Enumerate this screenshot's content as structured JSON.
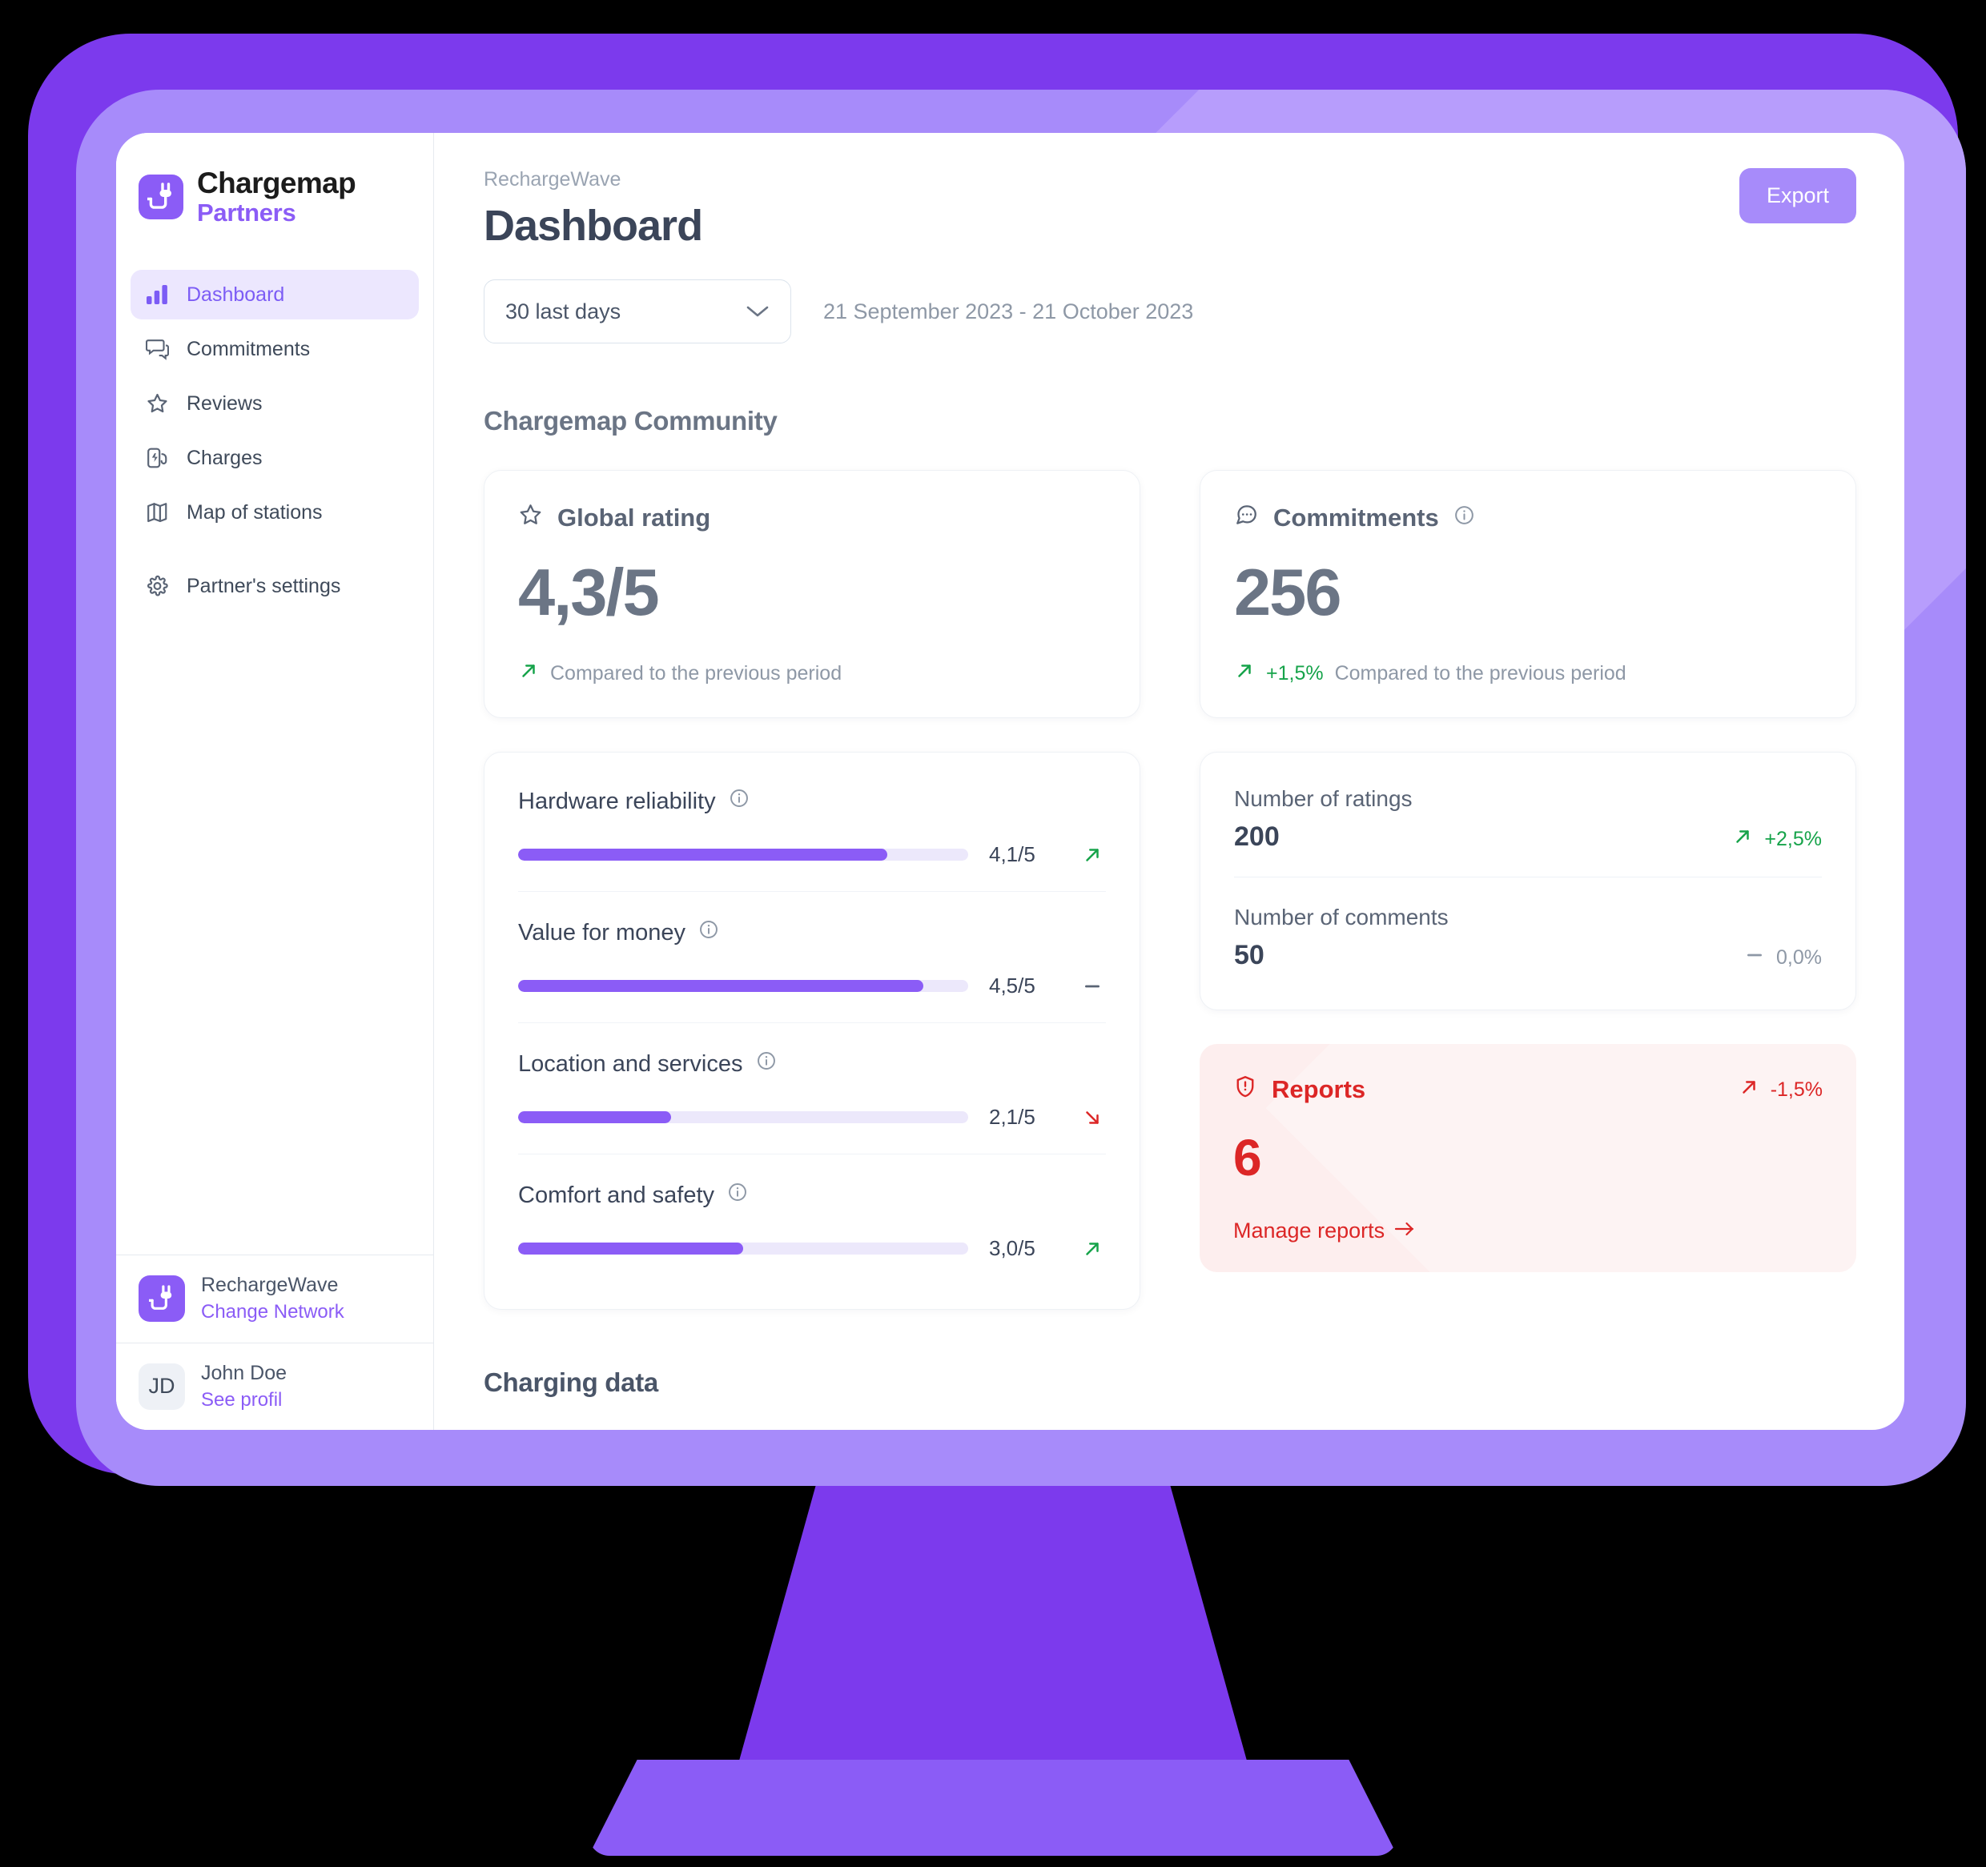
{
  "brand": {
    "name_line1": "Chargemap",
    "name_line2": "Partners",
    "accent": "#8b5cf6"
  },
  "sidebar": {
    "items": [
      {
        "label": "Dashboard",
        "icon": "bar-chart-icon",
        "active": true
      },
      {
        "label": "Commitments",
        "icon": "chat-bubbles-icon",
        "active": false
      },
      {
        "label": "Reviews",
        "icon": "star-icon",
        "active": false
      },
      {
        "label": "Charges",
        "icon": "charging-station-icon",
        "active": false
      },
      {
        "label": "Map of stations",
        "icon": "map-icon",
        "active": false
      },
      {
        "label": "Partner's settings",
        "icon": "gear-icon",
        "active": false
      }
    ],
    "network": {
      "name": "RechargeWave",
      "action": "Change Network"
    },
    "user": {
      "initials": "JD",
      "name": "John Doe",
      "action": "See profil"
    }
  },
  "header": {
    "breadcrumb": "RechargeWave",
    "title": "Dashboard",
    "export_label": "Export"
  },
  "filters": {
    "period_selected": "30 last days",
    "date_range": "21 September 2023 - 21 October 2023"
  },
  "sections": {
    "community": "Chargemap Community",
    "charging": "Charging data"
  },
  "global_rating": {
    "title": "Global rating",
    "icon": "star-icon",
    "value": "4,3/5",
    "trend_icon": "arrow-up-right-icon",
    "trend_color": "#16a34a",
    "compare_text": "Compared to the previous period"
  },
  "commitments": {
    "title": "Commitments",
    "icon": "chat-bubble-dots-icon",
    "has_info": true,
    "value": "256",
    "delta": "+1,5%",
    "delta_color": "#16a34a",
    "trend_icon": "arrow-up-right-icon",
    "compare_text": "Compared to the previous period"
  },
  "ratings": [
    {
      "label": "Hardware reliability",
      "value": "4,1/5",
      "fill_pct": 82,
      "trend": "up",
      "trend_icon": "arrow-up-right-icon"
    },
    {
      "label": "Value for money",
      "value": "4,5/5",
      "fill_pct": 90,
      "trend": "flat",
      "trend_icon": "dash-icon"
    },
    {
      "label": "Location and services",
      "value": "2,1/5",
      "fill_pct": 34,
      "trend": "down",
      "trend_icon": "arrow-down-right-icon"
    },
    {
      "label": "Comfort and safety",
      "value": "3,0/5",
      "fill_pct": 50,
      "trend": "up",
      "trend_icon": "arrow-up-right-icon"
    }
  ],
  "stats": [
    {
      "name": "Number of ratings",
      "value": "200",
      "delta": "+2,5%",
      "trend": "up",
      "trend_icon": "arrow-up-right-icon",
      "delta_color": "#16a34a"
    },
    {
      "name": "Number of comments",
      "value": "50",
      "delta": "0,0%",
      "trend": "flat",
      "trend_icon": "dash-icon",
      "delta_color": "#8e98a6"
    }
  ],
  "reports": {
    "title": "Reports",
    "icon": "shield-alert-icon",
    "delta": "-1,5%",
    "trend_icon": "arrow-up-right-icon",
    "value": "6",
    "link": "Manage reports",
    "link_arrow": "arrow-right-icon",
    "color": "#dc2626",
    "background": "#fdeeee"
  }
}
